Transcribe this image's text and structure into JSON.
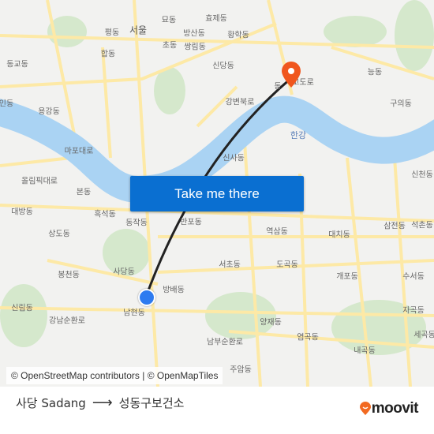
{
  "map": {
    "labels": [
      "묘동",
      "효제동",
      "평동",
      "서울",
      "방산동",
      "황학동",
      "초동",
      "쌍림동",
      "합동",
      "신당동",
      "능동",
      "구의동",
      "용강동",
      "인동",
      "동교동",
      "마포대로",
      "강변북로",
      "한강",
      "올림픽대로",
      "신사동",
      "본동",
      "흑석동",
      "동작동",
      "반포동",
      "역삼동",
      "대치동",
      "삼전동",
      "석촌동",
      "신천동",
      "대방동",
      "상도동",
      "사당동",
      "서초동",
      "도곡동",
      "개포동",
      "수서동",
      "봉천동",
      "방배동",
      "신림동",
      "남현동",
      "양재동",
      "자곡동",
      "세곡동",
      "남부순환로",
      "강남순환로",
      "염곡동",
      "내곡동",
      "주암동",
      "동",
      "고도로"
    ],
    "colors": {
      "water": "#aad3f3",
      "road": "#fde9a6",
      "park": "#d5e8cc",
      "route": "#222222",
      "origin": "#2d7bf0",
      "destination": "#f0561d"
    }
  },
  "cta": {
    "label": "Take me there"
  },
  "attribution": "© OpenStreetMap contributors | © OpenMapTiles",
  "footer": {
    "origin": "사당 Sadang",
    "arrow": "⟶",
    "destination": "성동구보건소",
    "logo": "moovit"
  }
}
